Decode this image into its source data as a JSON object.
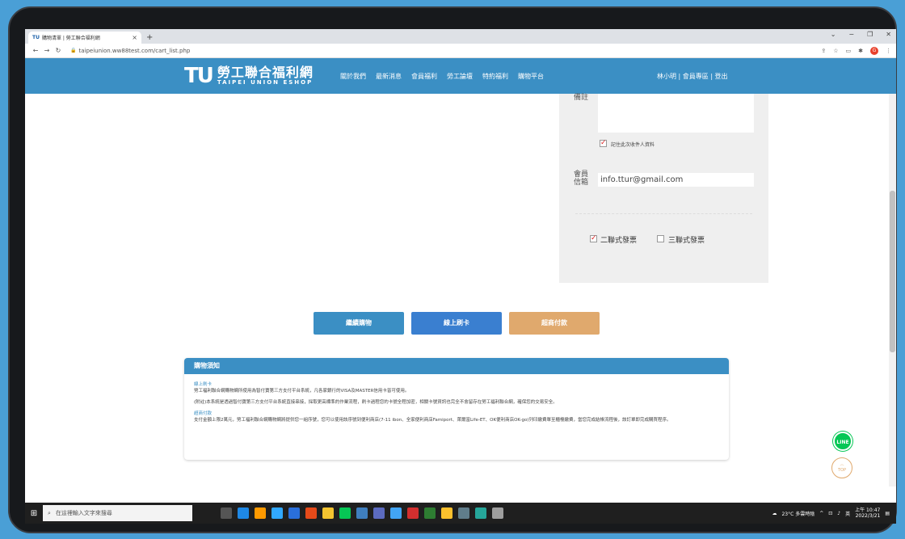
{
  "browser": {
    "tab_title": "購物清單 | 勞工聯合福利網",
    "tab_favicon": "TU",
    "new_tab": "+",
    "url": "taipeiunion.ww88test.com/cart_list.php",
    "window_controls": [
      "⌄",
      "−",
      "❐",
      "✕"
    ],
    "avatar_letter": "G"
  },
  "header": {
    "logo_mark": "TU",
    "logo_cn": "勞工聯合福利網",
    "logo_en": "TAIPEI UNION ESHOP",
    "nav": [
      "關於我們",
      "最新消息",
      "會員福利",
      "勞工論壇",
      "特約福利",
      "購物平台"
    ],
    "user_nav": "林小明 | 會員專區 | 登出"
  },
  "form": {
    "remark_label": "備註",
    "remember_label": "記住此次收件人資料",
    "email_label": "會員信箱",
    "email_value": "info.ttur@gmail.com",
    "invoice_two": "二聯式發票",
    "invoice_three": "三聯式發票"
  },
  "buttons": {
    "continue": "繼續購物",
    "card": "線上刷卡",
    "store": "超商付款"
  },
  "notice": {
    "title": "購物須知",
    "card_heading": "線上刷卡",
    "card_text1": "勞工福利聯合網購物網所使用為智付寶第三方支付平台系統，凡各家銀行的VISA及MASTER信用卡皆可使用。",
    "card_text2": "(附註)本系統是透過智付寶第三方支付平台系統直接串接，採取更高標準的作業流程，刷卡過程您的卡號全程加密，相關卡號資訊也完全不會留存在勞工福利聯合網，確保您的交易安全。",
    "store_heading": "超商付款",
    "store_text": "支付金額上限2萬元，勞工福利聯合網購物網將提供您一組序號，您可以使用該序號到便利商店(7-11 ibon、全家便利商店Famiport、萊爾富Life-ET、OK便利商店OK-go)列印繳費單至櫃檯繳費，當您完成結帳流程後，該訂單即完成購買程序。"
  },
  "floating": {
    "line": "LINE",
    "top": "TOP"
  },
  "taskbar": {
    "search_placeholder": "在這裡輸入文字來搜尋",
    "weather": "23°C 多雲時陰",
    "time": "上午 10:47",
    "date": "2022/3/21",
    "ime": "英"
  },
  "colors": {
    "header_blue": "#3b8fc4",
    "card_blue": "#3a7fd0",
    "store_orange": "#e0a96d",
    "line_green": "#06c755"
  }
}
